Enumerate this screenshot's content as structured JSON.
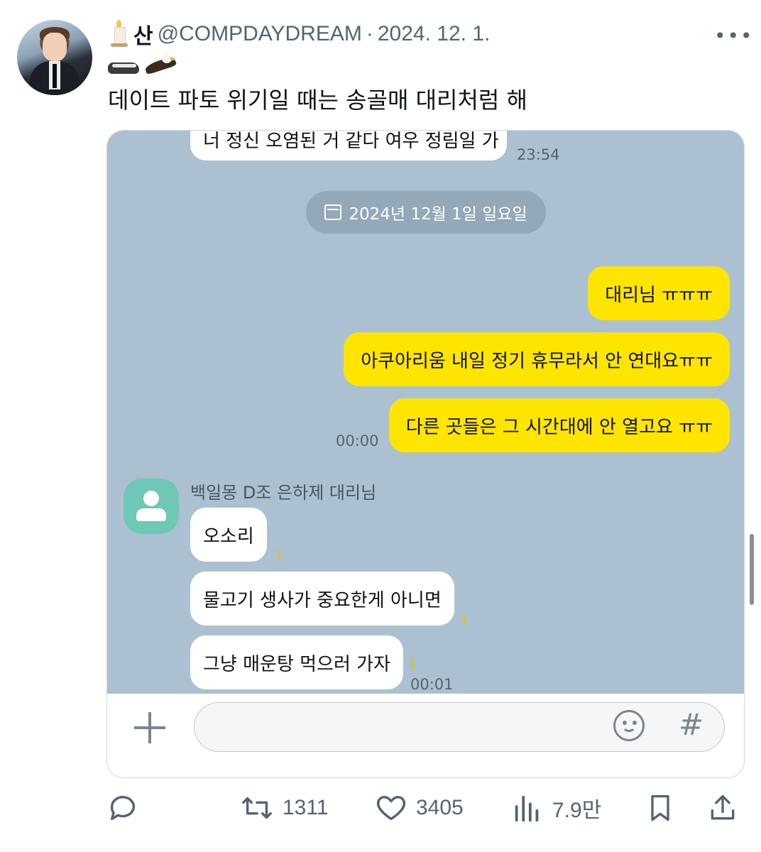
{
  "tweet": {
    "display_name": "산",
    "handle": "@COMPDAYDREAM",
    "separator": "·",
    "date": "2024. 12. 1.",
    "more": "•••",
    "text": "데이트 파토 위기일 때는 송골매 대리처럼 해",
    "icons": [
      "candle-emoji",
      "badger-emoji",
      "eagle-emoji"
    ]
  },
  "chat": {
    "background": "#abc1d1",
    "top_partial": {
      "text": "너 정신 오염된 거 같다 여우 정림일 가",
      "time": "23:54"
    },
    "date_divider": "2024년 12월 1일 일요일",
    "outgoing": [
      {
        "text": "대리님 ㅠㅠㅠ"
      },
      {
        "text": "아쿠아리움 내일 정기 휴무라서 안 연대요ㅠㅠ"
      },
      {
        "text": "다른 곳들은 그 시간대에 안 열고요 ㅠㅠ"
      }
    ],
    "outgoing_time": "00:00",
    "sender_name": "백일몽 D조 은하제 대리님",
    "incoming": [
      {
        "text": "오소리",
        "unread": "1"
      },
      {
        "text": "물고기 생사가 중요한게 아니면",
        "unread": "1"
      },
      {
        "text": "그냥 매운탕 먹으러 가자",
        "unread": "1"
      }
    ],
    "incoming_time": "00:01",
    "input": {
      "placeholder": "",
      "hash": "#"
    }
  },
  "actions": {
    "reply_count": "",
    "retweets": "1311",
    "likes": "3405",
    "views": "7.9만"
  },
  "colors": {
    "bubble_out": "#fee500",
    "bubble_in": "#ffffff",
    "text_secondary": "#536471"
  }
}
